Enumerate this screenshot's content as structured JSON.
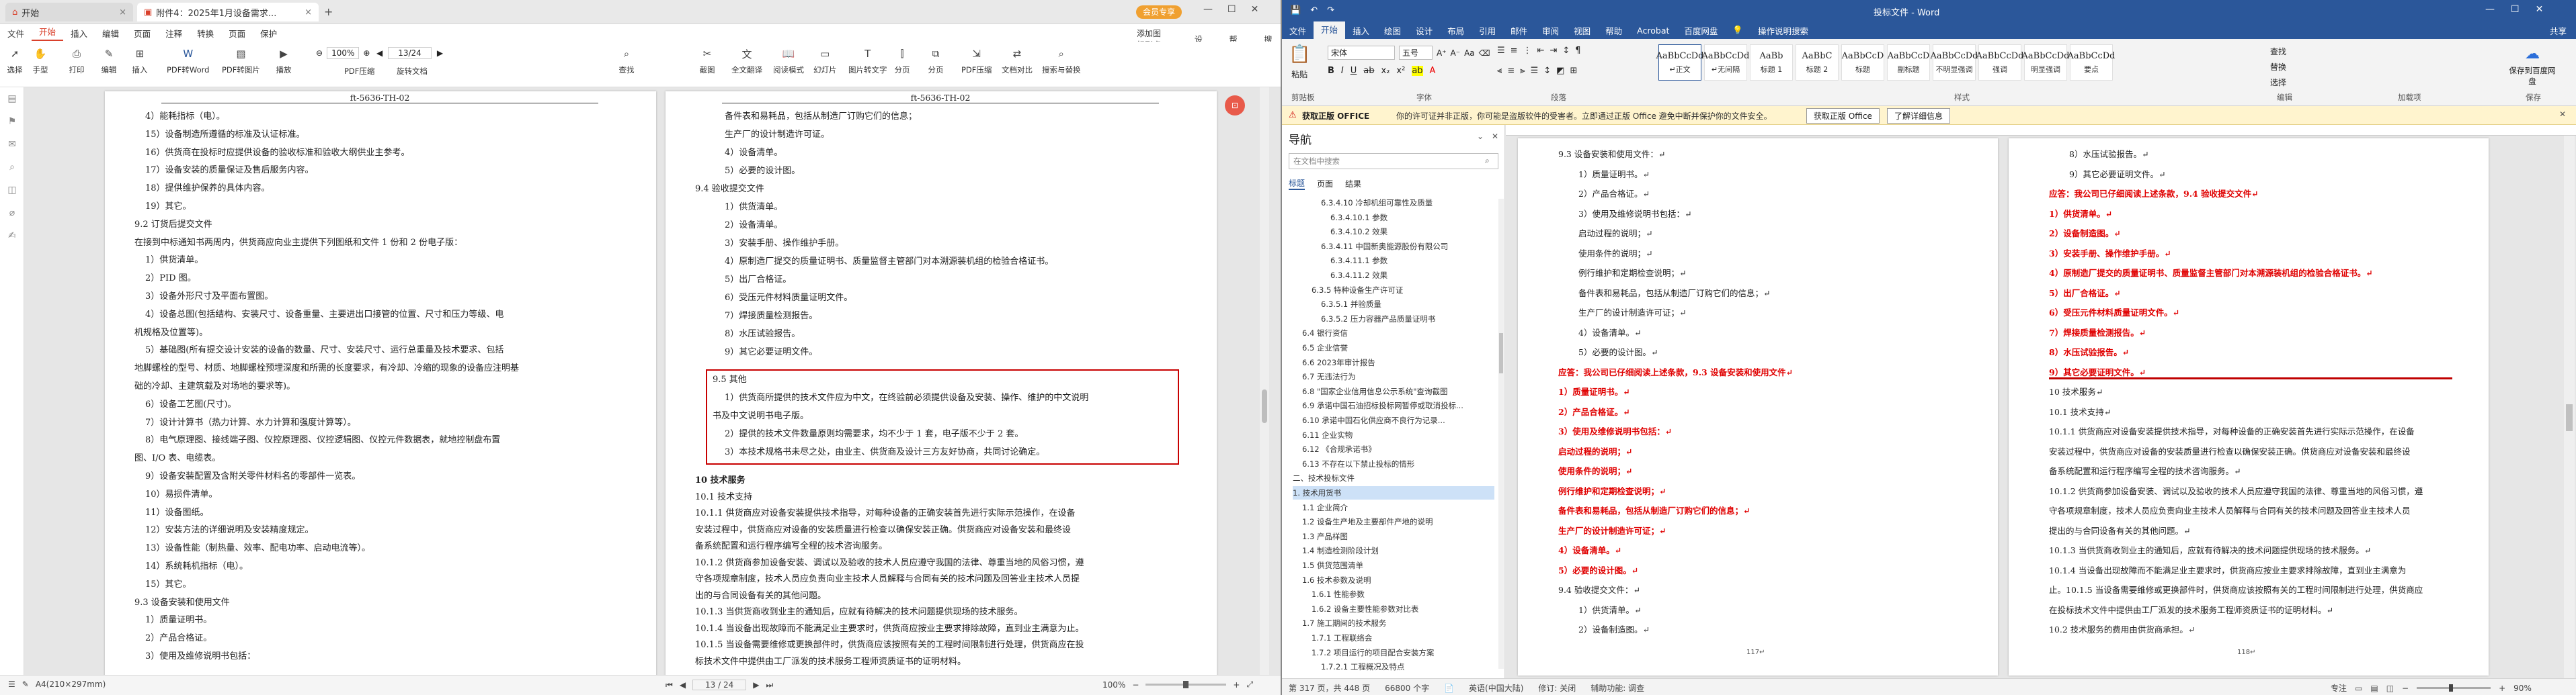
{
  "left_app": {
    "tabs": [
      {
        "label": "开始"
      },
      {
        "label": "附件4：2025年1月设备需求..."
      }
    ],
    "vip_badge": "会员专享",
    "menu": [
      "文件",
      "开始",
      "插入",
      "编辑",
      "页面",
      "注释",
      "转换",
      "页面",
      "保护"
    ],
    "menu_active": "开始",
    "menu_right": [
      "添加图标到桌面",
      "设置",
      "帮助",
      "搜索"
    ],
    "toolbar": {
      "select": "选择",
      "hand": "手型",
      "zoom_value": "100%",
      "page_indicator": "13/24",
      "buttons": [
        "打印",
        "编辑",
        "插入",
        "PDF转Word",
        "PDF转图片",
        "播放",
        "PDF压缩",
        "旋转文档",
        "查找",
        "截图",
        "全文翻译",
        "阅读模式",
        "幻灯片",
        "图片转文字",
        "分页",
        "分页",
        "PDF压缩",
        "文档对比",
        "搜索与替换"
      ]
    },
    "page_header": "ft-5636-TH-02",
    "page1_lines": [
      "4）能耗指标（电）。",
      "15）设备制造所遵循的标准及认证标准。",
      "16）供货商在投标时应提供设备的验收标准和验收大纲供业主参考。",
      "17）设备安装的质量保证及售后服务内容。",
      "18）提供维护保养的具体内容。",
      "19）其它。",
      "9.2 订货后提交文件",
      "在接到中标通知书两周内，供货商应向业主提供下列图纸和文件 1 份和 2 份电子版：",
      "1）供货清单。",
      "2）PID 图。",
      "3）设备外形尺寸及平面布置图。",
      "4）设备总图(包括结构、安装尺寸、设备重量、主要进出口接管的位置、尺寸和压力等级、电",
      "机规格及位置等)。",
      "5）基础图(所有提交设计安装的设备的数量、尺寸、安装尺寸、运行总重量及技术要求、包括",
      "地脚螺栓的型号、材质、地脚螺栓预埋深度和所需的长度要求，有冷却、冷缩的现象的设备应注明基",
      "础的冷却、主建筑载及对场地的要求等)。",
      "6）设备工艺图(尺寸)。",
      "7）设计计算书（热力计算、水力计算和强度计算等）。",
      "8）电气原理图、接线端子图、仪控原理图、仪控逻辑图、仪控元件数据表，就地控制盘布置",
      "图、I/O 表、电缆表。",
      "9）设备安装配置及含附关零件材料名的零部件一览表。",
      "10）易损件清单。",
      "11）设备图纸。",
      "12）安装方法的详细说明及安装精度规定。",
      "13）设备性能（制热量、效率、配电功率、启动电流等）。",
      "14）系统耗机指标（电）。",
      "15）其它。",
      "9.3 设备安装和使用文件",
      "1）质量证明书。",
      "2）产品合格证。",
      "3）使用及维修说明书包括："
    ],
    "page2_lines": [
      "备件表和易耗品，包括从制造厂订购它们的信息；",
      "生产厂的设计制造许可证。",
      "4）设备清单。",
      "5）必要的设计图。",
      "9.4 验收提交文件",
      "1）供货清单。",
      "2）设备清单。",
      "3）安装手册、操作维护手册。",
      "4）原制造厂提交的质量证明书、质量监督主管部门对本溯源装机组的检验合格证书。",
      "5）出厂合格证。",
      "6）受压元件材料质量证明文件。",
      "7）焊接质量检测报告。",
      "8）水压试验报告。",
      "9）其它必要证明文件。"
    ],
    "highlight_box_lines": [
      "9.5 其他",
      "1）供货商所提供的技术文件应为中文，在终验前必须提供设备及安装、操作、维护的中文说明",
      "书及中文说明书电子版。",
      "2）提供的技术文件数量原则均需要求，均不少于 1 套，电子版不少于 2 套。",
      "3）本技术规格书未尽之处，由业主、供货商及设计三方友好协商，共同讨论确定。"
    ],
    "page2_after": [
      "10 技术服务",
      "10.1 技术支持",
      "10.1.1 供货商应对设备安装提供技术指导，对每种设备的正确安装首先进行实际示范操作，在设备",
      "安装过程中，供货商应对设备的安装质量进行检查以确保安装正确。供货商应对设备安装和最终设",
      "备系统配置和运行程序编写全程的技术咨询服务。",
      "10.1.2 供货商参加设备安装、调试以及验收的技术人员应遵守我国的法律、尊重当地的风俗习惯，遵",
      "守各项规章制度，技术人员应负责向业主技术人员解释与合同有关的技术问题及回答业主技术人员提",
      "出的与合同设备有关的其他问题。",
      "10.1.3 当供货商收到业主的通知后，应就有待解决的技术问题提供现场的技术服务。",
      "10.1.4 当设备出现故障而不能满足业主要求时，供货商应按业主要求排除故障，直到业主满意为止。",
      "10.1.5 当设备需要维修或更换部件时，供货商应该按照有关的工程时间限制进行处理，供货商应在投",
      "标技术文件中提供由工厂派发的技术服务工程师资质证书的证明材料。"
    ],
    "status": {
      "page_size": "A4(210×297mm)",
      "page_nav": "13 / 24",
      "zoom": "100%"
    }
  },
  "right_app": {
    "title": "投标文件 - Word",
    "menu": [
      "文件",
      "开始",
      "插入",
      "绘图",
      "设计",
      "布局",
      "引用",
      "邮件",
      "审阅",
      "视图",
      "帮助",
      "Acrobat",
      "百度网盘",
      "操作说明搜索"
    ],
    "menu_active": "开始",
    "share": "共享",
    "ribbon": {
      "paste": "粘贴",
      "font_name": "宋体",
      "font_size": "五号",
      "styles": [
        {
          "sample": "AaBbCcDd",
          "name": "↵正文"
        },
        {
          "sample": "AaBbCcDd",
          "name": "↵无间隔"
        },
        {
          "sample": "AaBb",
          "name": "标题 1"
        },
        {
          "sample": "AaBbC",
          "name": "标题 2"
        },
        {
          "sample": "AaBbCcD",
          "name": "标题"
        },
        {
          "sample": "AaBbCcD",
          "name": "副标题"
        },
        {
          "sample": "AaBbCcDd",
          "name": "不明显强调"
        },
        {
          "sample": "AaBbCcDd",
          "name": "强调"
        },
        {
          "sample": "AaBbCcDd",
          "name": "明显强调"
        },
        {
          "sample": "AaBbCcDd",
          "name": "要点"
        }
      ],
      "groups": [
        "剪贴板",
        "字体",
        "段落",
        "样式",
        "编辑",
        "加载项",
        "保存"
      ],
      "edit": [
        "查找",
        "替换",
        "选择"
      ],
      "save_label": "保存到百度网盘"
    },
    "warning": {
      "label": "获取正版 OFFICE",
      "text": "你的许可证并非正版，你可能是盗版软件的受害者。立即通过正版 Office 避免中断并保护你的文件安全。",
      "btn1": "获取正版 Office",
      "btn2": "了解详细信息"
    },
    "nav": {
      "title": "导航",
      "search_placeholder": "在文档中搜索",
      "tabs": [
        "标题",
        "页面",
        "结果"
      ],
      "items": [
        "6.3.4.10 冷却机组可靠性及质量",
        "6.3.4.10.1 参数",
        "6.3.4.10.2 效果",
        "6.3.4.11 中国新奥能源股份有限公司",
        "6.3.4.11.1 参数",
        "6.3.4.11.2 效果",
        "6.3.5 特种设备生产许可证",
        "6.3.5.1 并验质量",
        "6.3.5.2 压力容器产品质量证明书",
        "6.4 银行资信",
        "6.5 企业信誉",
        "6.6 2023年审计报告",
        "6.7 无违法行为",
        "6.8 \"国家企业信用信息公示系统\"查询截图",
        "6.9 承诺中国石油招标投标网暂停或取消投标...",
        "6.10 承诺中国石化供应商不良行为记录...",
        "6.11 企业实物",
        "6.12 《合规承诺书》",
        "6.13 不存在以下禁止投标的情形",
        "二、技术投标文件",
        "1. 技术用货书",
        "1.1 企业简介",
        "1.2 设备生产地及主要部件产地的说明",
        "1.3 产品样图",
        "1.4 制造检测阶段计划",
        "1.5 供货范围清单",
        "1.6 技术参数及说明",
        "1.6.1 性能参数",
        "1.6.2 设备主要性能参数对比表",
        "1.7 施工期间的技术服务",
        "1.7.1 工程联络会",
        "1.7.2 项目运行的项目配合安装方案",
        "1.7.2.1 工程概况及特点"
      ]
    },
    "doc_page1": [
      {
        "t": "9.3 设备安装和使用文件：↵",
        "c": "n"
      },
      {
        "t": "1）质量证明书。↵",
        "c": "n"
      },
      {
        "t": "2）产品合格证。↵",
        "c": "n"
      },
      {
        "t": "3）使用及维修说明书包括：↵",
        "c": "n"
      },
      {
        "t": "启动过程的说明；↵",
        "c": "n"
      },
      {
        "t": "使用条件的说明；↵",
        "c": "n"
      },
      {
        "t": "例行维护和定期检查说明；↵",
        "c": "n"
      },
      {
        "t": "备件表和易耗品，包括从制造厂订购它们的信息；↵",
        "c": "n"
      },
      {
        "t": "生产厂的设计制造许可证；↵",
        "c": "n"
      },
      {
        "t": "4）设备清单。↵",
        "c": "n"
      },
      {
        "t": "5）必要的设计图。↵",
        "c": "n"
      },
      {
        "t": "应答：我公司已仔细阅读上述条款，9.3 设备安装和使用文件↵",
        "c": "r"
      },
      {
        "t": "1）质量证明书。↵",
        "c": "r"
      },
      {
        "t": "2）产品合格证。↵",
        "c": "r"
      },
      {
        "t": "3）使用及维修说明书包括：↵",
        "c": "r"
      },
      {
        "t": "启动过程的说明；↵",
        "c": "r"
      },
      {
        "t": "使用条件的说明；↵",
        "c": "r"
      },
      {
        "t": "例行维护和定期检查说明；↵",
        "c": "r"
      },
      {
        "t": "备件表和易耗品，包括从制造厂订购它们的信息；↵",
        "c": "r"
      },
      {
        "t": "生产厂的设计制造许可证；↵",
        "c": "r"
      },
      {
        "t": "4）设备清单。↵",
        "c": "r"
      },
      {
        "t": "5）必要的设计图。↵",
        "c": "r"
      },
      {
        "t": "9.4 验收提交文件：↵",
        "c": "n"
      },
      {
        "t": "1）供货清单。↵",
        "c": "n"
      },
      {
        "t": "2）设备制造图。↵",
        "c": "n"
      }
    ],
    "doc_page2": [
      {
        "t": "8）水压试验报告。↵",
        "c": "n"
      },
      {
        "t": "9）其它必要证明文件。↵",
        "c": "n"
      },
      {
        "t": "应答：我公司已仔细阅读上述条款，9.4 验收提交文件↵",
        "c": "r"
      },
      {
        "t": "1）供货清单。↵",
        "c": "r"
      },
      {
        "t": "2）设备制造图。↵",
        "c": "r"
      },
      {
        "t": "3）安装手册、操作维护手册。↵",
        "c": "r"
      },
      {
        "t": "4）原制造厂提交的质量证明书、质量监督主管部门对本溯源装机组的检验合格证书。↵",
        "c": "r"
      },
      {
        "t": "5）出厂合格证。↵",
        "c": "r"
      },
      {
        "t": "6）受压元件材料质量证明文件。↵",
        "c": "r"
      },
      {
        "t": "7）焊接质量检测报告。↵",
        "c": "r"
      },
      {
        "t": "8）水压试验报告。↵",
        "c": "r"
      },
      {
        "t": "9）其它必要证明文件。↵",
        "c": "r"
      },
      {
        "t": "10 技术服务↵",
        "c": "n"
      },
      {
        "t": "10.1 技术支持↵",
        "c": "n"
      },
      {
        "t": "10.1.1 供货商应对设备安装提供技术指导，对每种设备的正确安装首先进行实际示范操作，在设备",
        "c": "n"
      },
      {
        "t": "安装过程中，供货商应对设备的安装质量进行检查以确保安装正确。供货商应对设备安装和最终设",
        "c": "n"
      },
      {
        "t": "备系统配置和运行程序编写全程的技术咨询服务。↵",
        "c": "n"
      },
      {
        "t": "10.1.2 供货商参加设备安装、调试以及验收的技术人员应遵守我国的法律、尊重当地的风俗习惯，遵",
        "c": "n"
      },
      {
        "t": "守各项规章制度，技术人员应负责向业主技术人员解释与合同有关的技术问题及回答业主技术人员",
        "c": "n"
      },
      {
        "t": "提出的与合同设备有关的其他问题。↵",
        "c": "n"
      },
      {
        "t": "10.1.3 当供货商收到业主的通知后，应就有待解决的技术问题提供现场的技术服务。↵",
        "c": "n"
      },
      {
        "t": "10.1.4 当设备出现故障而不能满足业主要求时，供货商应按业主要求排除故障，直到业主满意为",
        "c": "n"
      },
      {
        "t": "止。10.1.5 当设备需要维修或更换部件时，供货商应该按照有关的工程时间限制进行处理，供货商应",
        "c": "n"
      },
      {
        "t": "在投标技术文件中提供由工厂派发的技术服务工程师资质证书的证明材料。↵",
        "c": "n"
      },
      {
        "t": "10.2 技术服务的费用由供货商承担。↵",
        "c": "n"
      }
    ],
    "page_numbers": [
      "117↵",
      "118↵"
    ],
    "status": {
      "page": "第 317 页，共 448 页",
      "words": "66800 个字",
      "lang": "英语(中国大陆)",
      "track": "修订: 关闭",
      "accessibility": "辅助功能: 调查",
      "focus": "专注",
      "zoom": "90%"
    }
  }
}
